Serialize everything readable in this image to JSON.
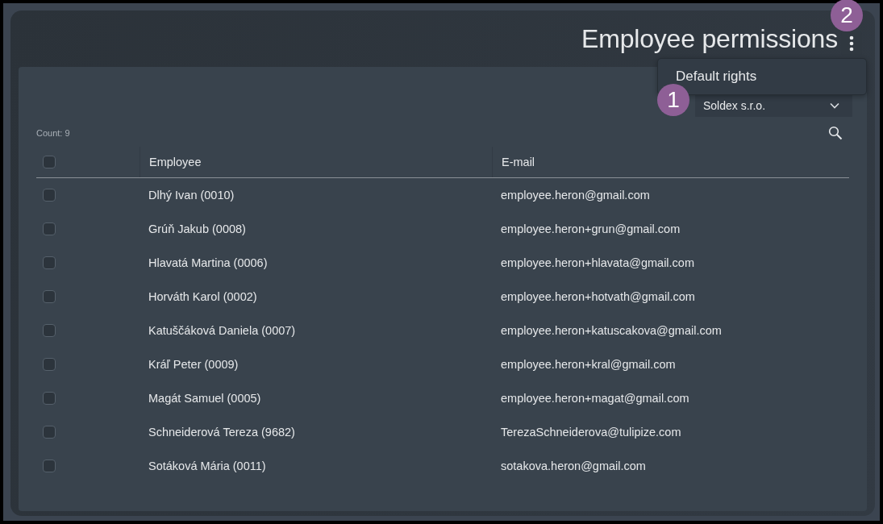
{
  "header": {
    "title": "Employee permissions"
  },
  "menu": {
    "items": [
      {
        "label": "Default rights"
      }
    ]
  },
  "company_select": {
    "value": "Soldex s.r.o."
  },
  "annotations": [
    {
      "label": "1"
    },
    {
      "label": "2"
    }
  ],
  "count": "Count: 9",
  "table": {
    "select_all": {
      "checked": false
    },
    "columns": [
      "Employee",
      "E-mail"
    ],
    "rows": [
      {
        "checked": false,
        "employee": "Dlhý Ivan (0010)",
        "email": "employee.heron@gmail.com"
      },
      {
        "checked": false,
        "employee": "Grúň Jakub (0008)",
        "email": "employee.heron+grun@gmail.com"
      },
      {
        "checked": false,
        "employee": "Hlavatá Martina (0006)",
        "email": "employee.heron+hlavata@gmail.com"
      },
      {
        "checked": false,
        "employee": "Horváth Karol (0002)",
        "email": "employee.heron+hotvath@gmail.com"
      },
      {
        "checked": false,
        "employee": "Katuščáková Daniela (0007)",
        "email": "employee.heron+katuscakova@gmail.com"
      },
      {
        "checked": false,
        "employee": "Kráľ Peter (0009)",
        "email": "employee.heron+kral@gmail.com"
      },
      {
        "checked": false,
        "employee": "Magát Samuel (0005)",
        "email": "employee.heron+magat@gmail.com"
      },
      {
        "checked": false,
        "employee": "Schneiderová Tereza (9682)",
        "email": "TerezaSchneiderova@tulipize.com"
      },
      {
        "checked": false,
        "employee": "Sotáková Mária (0011)",
        "email": "sotakova.heron@gmail.com"
      }
    ]
  }
}
